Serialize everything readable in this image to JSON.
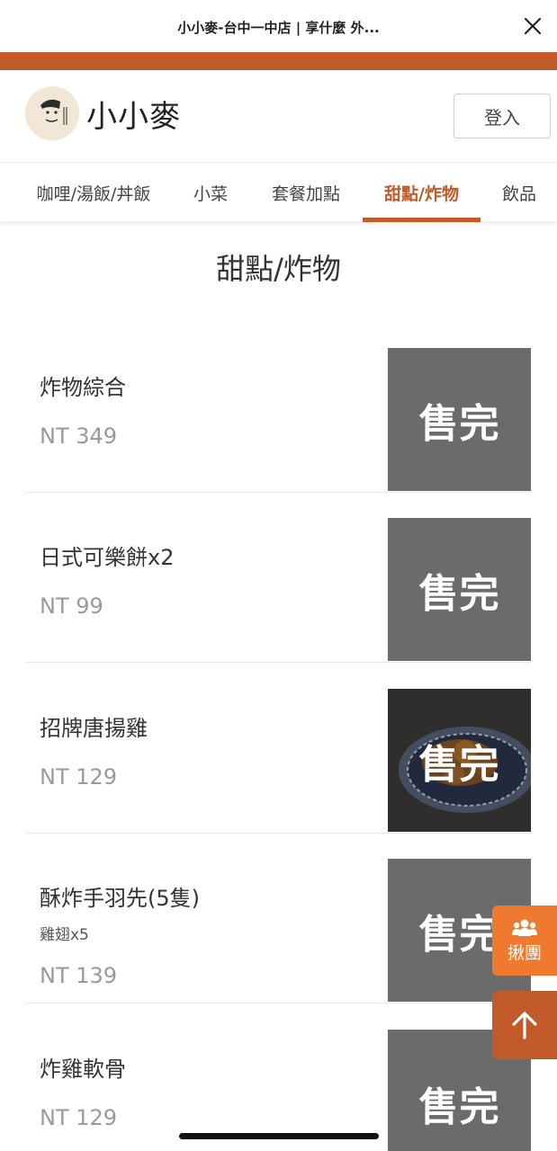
{
  "browser": {
    "title": "小小麥-台中一中店 | 享什麼 外...",
    "close_icon": "close-icon"
  },
  "header": {
    "shop_name": "小小麥",
    "login_label": "登入",
    "logo_icon": "shop-logo"
  },
  "tabs": [
    {
      "label": "咖哩/湯飯/丼飯",
      "active": false
    },
    {
      "label": "小菜",
      "active": false
    },
    {
      "label": "套餐加點",
      "active": false
    },
    {
      "label": "甜點/炸物",
      "active": true
    },
    {
      "label": "飲品",
      "active": false
    }
  ],
  "section": {
    "title": "甜點/炸物"
  },
  "items": [
    {
      "name": "炸物綜合",
      "desc": "",
      "price": "NT 349",
      "status": "售完",
      "has_photo": false
    },
    {
      "name": "日式可樂餅x2",
      "desc": "",
      "price": "NT 99",
      "status": "售完",
      "has_photo": false
    },
    {
      "name": "招牌唐揚雞",
      "desc": "",
      "price": "NT 129",
      "status": "售完",
      "has_photo": true
    },
    {
      "name": "酥炸手羽先(5隻)",
      "desc": "雞翅x5",
      "price": "NT 139",
      "status": "售完",
      "has_photo": false
    },
    {
      "name": "炸雞軟骨",
      "desc": "",
      "price": "NT 129",
      "status": "售完",
      "has_photo": false
    }
  ],
  "floating": {
    "group_label": "揪團",
    "group_icon": "people-icon",
    "top_icon": "arrow-up-icon"
  },
  "colors": {
    "accent": "#c25a2a",
    "group_button": "#ef7a2f",
    "soldout_bg": "#6b6b6b"
  }
}
